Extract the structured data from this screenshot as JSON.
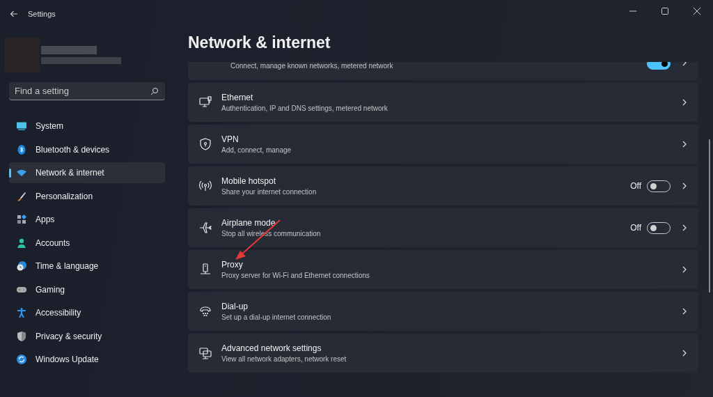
{
  "window": {
    "title": "Settings"
  },
  "search": {
    "placeholder": "Find a setting"
  },
  "sidebar": {
    "items": [
      {
        "label": "System",
        "selected": false
      },
      {
        "label": "Bluetooth & devices",
        "selected": false
      },
      {
        "label": "Network & internet",
        "selected": true
      },
      {
        "label": "Personalization",
        "selected": false
      },
      {
        "label": "Apps",
        "selected": false
      },
      {
        "label": "Accounts",
        "selected": false
      },
      {
        "label": "Time & language",
        "selected": false
      },
      {
        "label": "Gaming",
        "selected": false
      },
      {
        "label": "Accessibility",
        "selected": false
      },
      {
        "label": "Privacy & security",
        "selected": false
      },
      {
        "label": "Windows Update",
        "selected": false
      }
    ]
  },
  "page_title": "Network & internet",
  "cards": [
    {
      "kind": "cut",
      "description": "Connect, manage known networks, metered network",
      "toggle": {
        "on": true
      }
    },
    {
      "kind": "link",
      "title": "Ethernet",
      "description": "Authentication, IP and DNS settings, metered network"
    },
    {
      "kind": "link",
      "title": "VPN",
      "description": "Add, connect, manage"
    },
    {
      "kind": "toggle",
      "title": "Mobile hotspot",
      "description": "Share your internet connection",
      "state_text": "Off",
      "toggle": {
        "on": false
      }
    },
    {
      "kind": "toggle",
      "title": "Airplane mode",
      "description": "Stop all wireless communication",
      "state_text": "Off",
      "toggle": {
        "on": false
      }
    },
    {
      "kind": "link",
      "title": "Proxy",
      "description": "Proxy server for Wi-Fi and Ethernet connections"
    },
    {
      "kind": "link",
      "title": "Dial-up",
      "description": "Set up a dial-up internet connection"
    },
    {
      "kind": "link",
      "title": "Advanced network settings",
      "description": "View all network adapters, network reset"
    }
  ]
}
